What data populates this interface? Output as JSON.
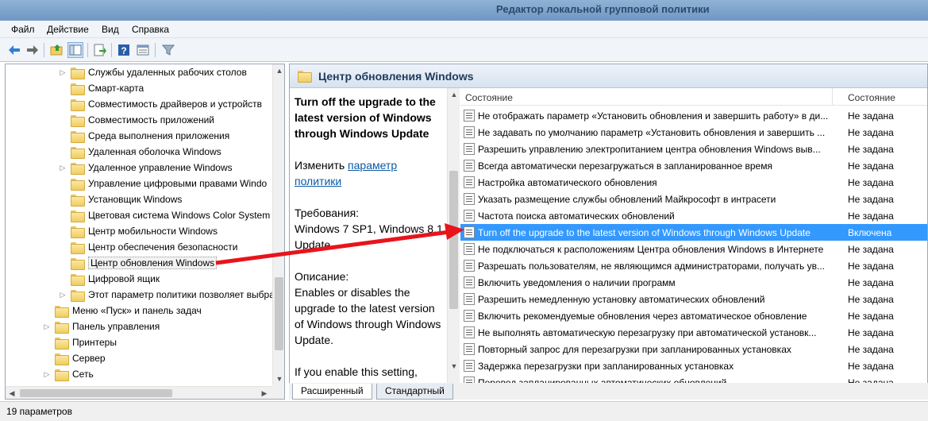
{
  "window": {
    "title": "Редактор локальной групповой политики"
  },
  "menu": [
    "Файл",
    "Действие",
    "Вид",
    "Справка"
  ],
  "toolbar": {
    "icons": [
      "back-icon",
      "forward-icon",
      "up-folder-icon",
      "show-hide-tree-icon",
      "export-list-icon",
      "help-icon",
      "properties-icon",
      "filter-icon"
    ]
  },
  "tree": {
    "items": [
      {
        "label": "Службы удаленных рабочих столов",
        "expandable": true
      },
      {
        "label": "Смарт-карта",
        "expandable": false
      },
      {
        "label": "Совместимость драйверов и устройств",
        "expandable": false
      },
      {
        "label": "Совместимость приложений",
        "expandable": false
      },
      {
        "label": "Среда выполнения приложения",
        "expandable": false
      },
      {
        "label": "Удаленная оболочка Windows",
        "expandable": false
      },
      {
        "label": "Удаленное управление Windows",
        "expandable": true
      },
      {
        "label": "Управление цифровыми правами Windo",
        "expandable": false
      },
      {
        "label": "Установщик Windows",
        "expandable": false
      },
      {
        "label": "Цветовая система Windows Color System",
        "expandable": false
      },
      {
        "label": "Центр мобильности Windows",
        "expandable": false
      },
      {
        "label": "Центр обеспечения безопасности",
        "expandable": false
      },
      {
        "label": "Центр обновления Windows",
        "expandable": false,
        "selected": true
      },
      {
        "label": "Цифровой ящик",
        "expandable": false
      },
      {
        "label": "Этот параметр политики позволяет выбра",
        "expandable": true
      },
      {
        "label": "Меню «Пуск» и панель задач",
        "expandable": false
      },
      {
        "label": "Панель управления",
        "expandable": true
      },
      {
        "label": "Принтеры",
        "expandable": false
      },
      {
        "label": "Сервер",
        "expandable": false
      },
      {
        "label": "Сеть",
        "expandable": true
      }
    ]
  },
  "right": {
    "title": "Центр обновления Windows",
    "description": {
      "policy_title": "Turn off the upgrade to the latest version of Windows through Windows Update",
      "edit_prefix": "Изменить ",
      "edit_link": "параметр политики",
      "requirements_label": "Требования:",
      "requirements_value": "Windows 7 SP1, Windows 8.1 Update",
      "description_label": "Описание:",
      "description_text": "Enables or disables the upgrade to the latest version of Windows through Windows Update.",
      "more_text": "If you enable this setting,"
    },
    "list": {
      "col_name": "Состояние",
      "col_state": "Состояние",
      "rows": [
        {
          "name": "Не отображать параметр «Установить обновления и завершить работу» в ди...",
          "state": "Не задана"
        },
        {
          "name": "Не задавать по умолчанию параметр «Установить обновления и завершить ...",
          "state": "Не задана"
        },
        {
          "name": "Разрешить управлению электропитанием центра обновления Windows выв...",
          "state": "Не задана"
        },
        {
          "name": "Всегда автоматически перезагружаться в запланированное время",
          "state": "Не задана"
        },
        {
          "name": "Настройка автоматического обновления",
          "state": "Не задана"
        },
        {
          "name": "Указать размещение службы обновлений Майкрософт в интрасети",
          "state": "Не задана"
        },
        {
          "name": "Частота поиска автоматических обновлений",
          "state": "Не задана"
        },
        {
          "name": "Turn off the upgrade to the latest version of Windows through Windows Update",
          "state": "Включена",
          "selected": true
        },
        {
          "name": "Не подключаться к расположениям Центра обновления Windows в Интернете",
          "state": "Не задана"
        },
        {
          "name": "Разрешать пользователям, не являющимся администраторами, получать ув...",
          "state": "Не задана"
        },
        {
          "name": "Включить уведомления о наличии программ",
          "state": "Не задана"
        },
        {
          "name": "Разрешить немедленную установку автоматических обновлений",
          "state": "Не задана"
        },
        {
          "name": "Включить рекомендуемые обновления через автоматическое обновление",
          "state": "Не задана"
        },
        {
          "name": "Не выполнять автоматическую перезагрузку при автоматической установк...",
          "state": "Не задана"
        },
        {
          "name": "Повторный запрос для перезагрузки при запланированных установках",
          "state": "Не задана"
        },
        {
          "name": "Задержка перезагрузки при запланированных установках",
          "state": "Не задана"
        },
        {
          "name": "Перевод запланированных автоматических обновлений",
          "state": "Не задана"
        }
      ]
    },
    "tabs": [
      "Расширенный",
      "Стандартный"
    ]
  },
  "status": {
    "text": "19 параметров"
  },
  "colors": {
    "selection": "#3399ff",
    "annotation_arrow": "#e8141b",
    "link": "#0b5aa8"
  }
}
